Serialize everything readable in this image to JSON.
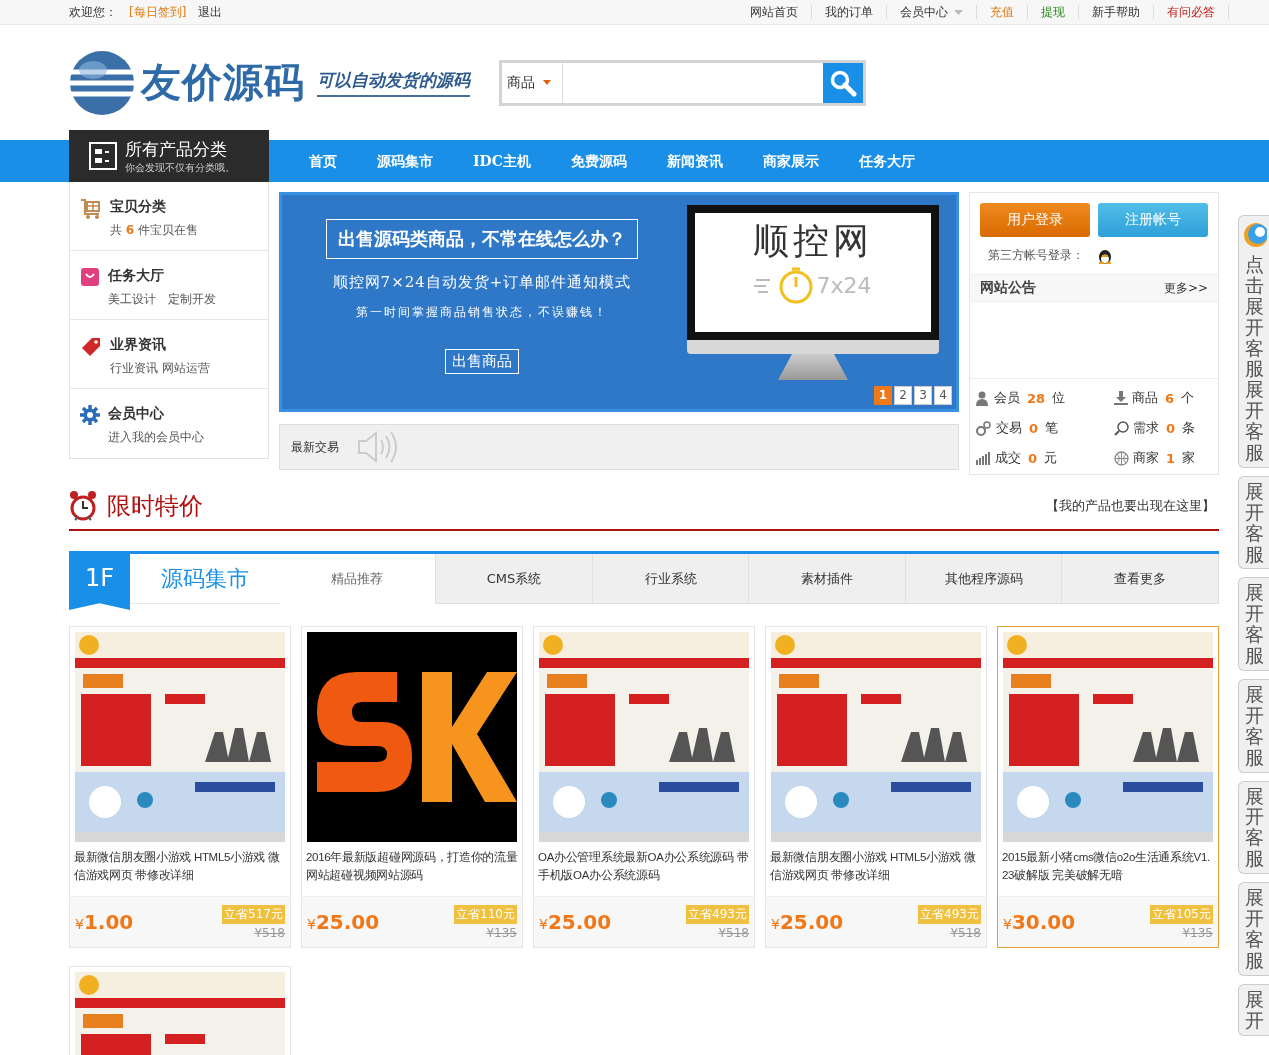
{
  "topbar": {
    "welcome": "欢迎您：",
    "signin": "[每日签到]",
    "logout": "退出",
    "links": [
      {
        "label": "网站首页",
        "kind": "plain",
        "dropdown": false
      },
      {
        "label": "我的订单",
        "kind": "plain",
        "dropdown": false
      },
      {
        "label": "会员中心",
        "kind": "plain",
        "dropdown": true
      },
      {
        "label": "充值",
        "kind": "accent",
        "dropdown": false
      },
      {
        "label": "提现",
        "kind": "positive",
        "dropdown": false
      },
      {
        "label": "新手帮助",
        "kind": "plain",
        "dropdown": false
      },
      {
        "label": "有问必答",
        "kind": "alert",
        "dropdown": false
      }
    ]
  },
  "header": {
    "logo": "友价源码",
    "slogan": "可以自动发货的源码",
    "search": {
      "scope": "商品"
    }
  },
  "nav": {
    "category_title": "所有产品分类",
    "category_sub": "你会发现不仅有分类哦。",
    "items": [
      "首页",
      "源码集市",
      "IDC主机",
      "免费源码",
      "新闻资讯",
      "商家展示",
      "任务大厅"
    ]
  },
  "sidebar": [
    {
      "title": "宝贝分类",
      "sub": "共 **6** 件宝贝在售"
    },
    {
      "title": "任务大厅",
      "sub": "美工设计　定制开发"
    },
    {
      "title": "业界资讯",
      "sub": "行业资讯 网站运营"
    },
    {
      "title": "会员中心",
      "sub": "进入我的会员中心"
    }
  ],
  "banner": {
    "headline": "出售源码类商品，不常在线怎么办？",
    "line1": "顺控网7×24自动发货+订单邮件通知模式",
    "line2": "第一时间掌握商品销售状态，不误赚钱！",
    "button": "出售商品",
    "screen_title": "顺控网",
    "screen_sub": "7x24",
    "pages": [
      {
        "label": "1",
        "selected": true
      },
      {
        "label": "2",
        "selected": false
      },
      {
        "label": "3",
        "selected": false
      },
      {
        "label": "4",
        "selected": false
      }
    ]
  },
  "ticker": {
    "label": "最新交易"
  },
  "account": {
    "login": "用户登录",
    "register": "注册帐号",
    "third_party": "第三方帐号登录：",
    "notice_title": "网站公告",
    "more": "更多>>",
    "stats": [
      {
        "label": "会员",
        "value": "28",
        "unit": "位"
      },
      {
        "label": "商品",
        "value": "6",
        "unit": "个"
      },
      {
        "label": "交易",
        "value": "0",
        "unit": "笔"
      },
      {
        "label": "需求",
        "value": "0",
        "unit": "条"
      },
      {
        "label": "成交",
        "value": "0",
        "unit": "元"
      },
      {
        "label": "商家",
        "value": "1",
        "unit": "家"
      }
    ]
  },
  "section": {
    "title": "限时特价",
    "link": "【我的产品也要出现在这里】"
  },
  "floor": {
    "number": "1F",
    "title": "源码集市",
    "tabs": [
      {
        "label": "精品推荐",
        "selected": true
      },
      {
        "label": "CMS系统",
        "selected": false
      },
      {
        "label": "行业系统",
        "selected": false
      },
      {
        "label": "素材插件",
        "selected": false
      },
      {
        "label": "其他程序源码",
        "selected": false
      },
      {
        "label": "查看更多",
        "selected": false
      }
    ]
  },
  "products": [
    {
      "kind": "picture",
      "title": "最新微信朋友圈小游戏 HTML5小游戏 微信游戏网页 带修改详细",
      "currency": "¥",
      "price": "1.00",
      "save": "立省517元",
      "original": "¥518",
      "highlighted": false
    },
    {
      "kind": "picture",
      "title": "2016年最新版超碰网源码，打造你的流量网站超碰视频网站源码",
      "currency": "¥",
      "price": "25.00",
      "save": "立省110元",
      "original": "¥135",
      "highlighted": false
    },
    {
      "kind": "picture",
      "title": "OA办公管理系统最新OA办公系统源码 带手机版OA办公系统源码",
      "currency": "¥",
      "price": "25.00",
      "save": "立省493元",
      "original": "¥518",
      "highlighted": false
    },
    {
      "kind": "picture",
      "title": "最新微信朋友圈小游戏 HTML5小游戏 微信游戏网页 带修改详细",
      "currency": "¥",
      "price": "25.00",
      "save": "立省493元",
      "original": "¥518",
      "highlighted": false
    },
    {
      "kind": "picture",
      "title": "2015最新小猪cms微信o2o生活通系统V1.23破解版 完美破解无暗",
      "currency": "¥",
      "price": "30.00",
      "save": "立省105元",
      "original": "¥135",
      "highlighted": true
    },
    {
      "kind": "picture",
      "highlighted": false
    }
  ],
  "service_tabs": [
    "点击展开客服展开客服",
    "展开客服",
    "展开客服",
    "展开客服",
    "展开客服",
    "展开客服",
    "展开"
  ]
}
